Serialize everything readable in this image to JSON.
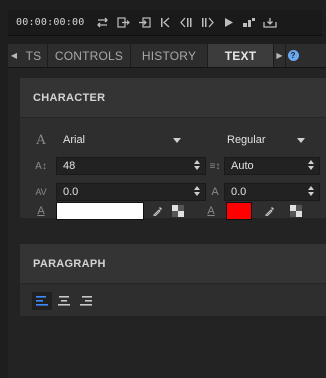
{
  "toolbar": {
    "timecode": "00:00:00:00",
    "icons": [
      "loop-icon",
      "export-icon",
      "import-icon",
      "skip-back-icon",
      "step-back-icon",
      "step-forward-icon",
      "play-icon",
      "scene-icon",
      "save-icon"
    ]
  },
  "tabs": {
    "items": [
      {
        "label": "TS",
        "active": false
      },
      {
        "label": "CONTROLS",
        "active": false
      },
      {
        "label": "HISTORY",
        "active": false
      },
      {
        "label": "TEXT",
        "active": true
      }
    ],
    "help_glyph": "?"
  },
  "character": {
    "title": "CHARACTER",
    "font": "Arial",
    "style": "Regular",
    "size": "48",
    "leading": "Auto",
    "tracking": "0.0",
    "baseline_shift": "0.0",
    "fill_color": "#ffffff",
    "stroke_color": "#ff0000"
  },
  "paragraph": {
    "title": "PARAGRAPH",
    "alignment": "left"
  },
  "colors": {
    "accent": "#3d8bfd",
    "background": "#1e1e1e",
    "panel": "#2e2e2e"
  }
}
